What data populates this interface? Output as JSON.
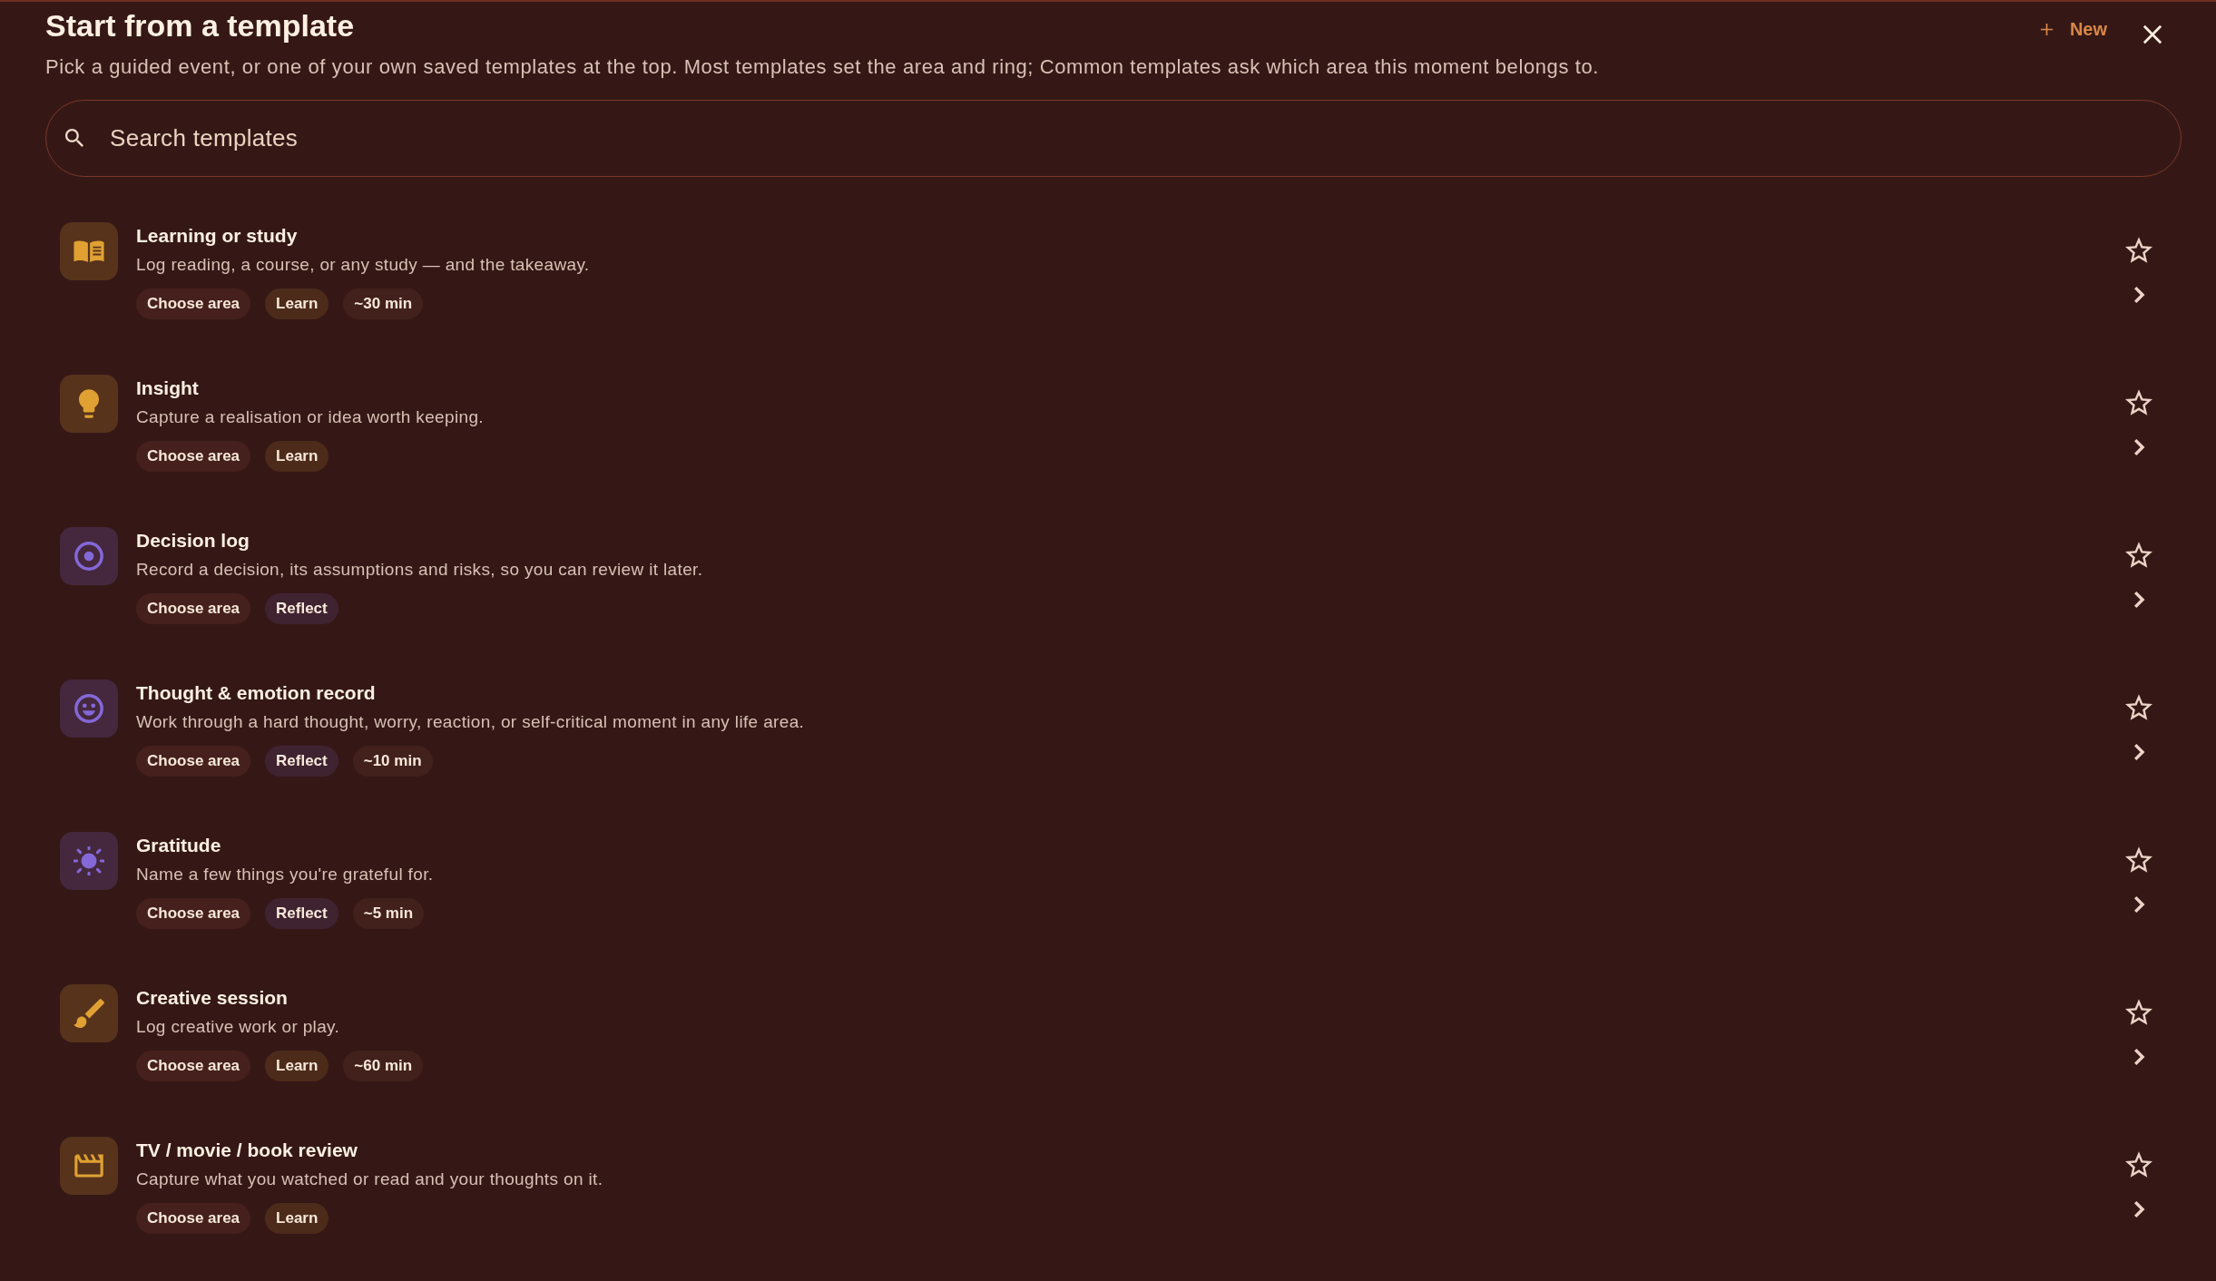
{
  "dialog": {
    "title": "Start from a template",
    "subtitle": "Pick a guided event, or one of your own saved templates at the top. Most templates set the area and ring; Common templates ask which area this moment belongs to.",
    "new_button": "New"
  },
  "search": {
    "placeholder": "Search templates"
  },
  "templates": [
    {
      "kind": "book",
      "color": "#e0a132",
      "title": "Learning or study",
      "description": "Log reading, a course, or any study — and the takeaway.",
      "starred": false,
      "tags": [
        {
          "kind": "area",
          "label": "Choose area"
        },
        {
          "kind": "category",
          "label": "Learn"
        },
        {
          "kind": "duration",
          "label": "~30 min"
        }
      ]
    },
    {
      "kind": "bulb",
      "color": "#e0a132",
      "title": "Insight",
      "description": "Capture a realisation or idea worth keeping.",
      "starred": false,
      "tags": [
        {
          "kind": "area",
          "label": "Choose area"
        },
        {
          "kind": "category",
          "label": "Learn"
        }
      ]
    },
    {
      "kind": "target",
      "color": "#8468d8",
      "title": "Decision log",
      "description": "Record a decision, its assumptions and risks, so you can review it later.",
      "starred": false,
      "tags": [
        {
          "kind": "area",
          "label": "Choose area"
        },
        {
          "kind": "category",
          "label": "Reflect"
        }
      ]
    },
    {
      "kind": "smiley",
      "color": "#8468d8",
      "title": "Thought & emotion record",
      "description": "Work through a hard thought, worry, reaction, or self-critical moment in any life area.",
      "starred": false,
      "tags": [
        {
          "kind": "area",
          "label": "Choose area"
        },
        {
          "kind": "category",
          "label": "Reflect"
        },
        {
          "kind": "duration",
          "label": "~10 min"
        }
      ]
    },
    {
      "kind": "sun",
      "color": "#8468d8",
      "title": "Gratitude",
      "description": "Name a few things you're grateful for.",
      "starred": false,
      "tags": [
        {
          "kind": "area",
          "label": "Choose area"
        },
        {
          "kind": "category",
          "label": "Reflect"
        },
        {
          "kind": "duration",
          "label": "~5 min"
        }
      ]
    },
    {
      "kind": "brush",
      "color": "#e0a132",
      "title": "Creative session",
      "description": "Log creative work or play.",
      "starred": false,
      "tags": [
        {
          "kind": "area",
          "label": "Choose area"
        },
        {
          "kind": "category",
          "label": "Learn"
        },
        {
          "kind": "duration",
          "label": "~60 min"
        }
      ]
    },
    {
      "kind": "clapperboard",
      "color": "#e0a132",
      "title": "TV / movie / book review",
      "description": "Capture what you watched or read and your thoughts on it.",
      "starred": false,
      "tags": [
        {
          "kind": "area",
          "label": "Choose area"
        },
        {
          "kind": "category",
          "label": "Learn"
        }
      ]
    }
  ]
}
